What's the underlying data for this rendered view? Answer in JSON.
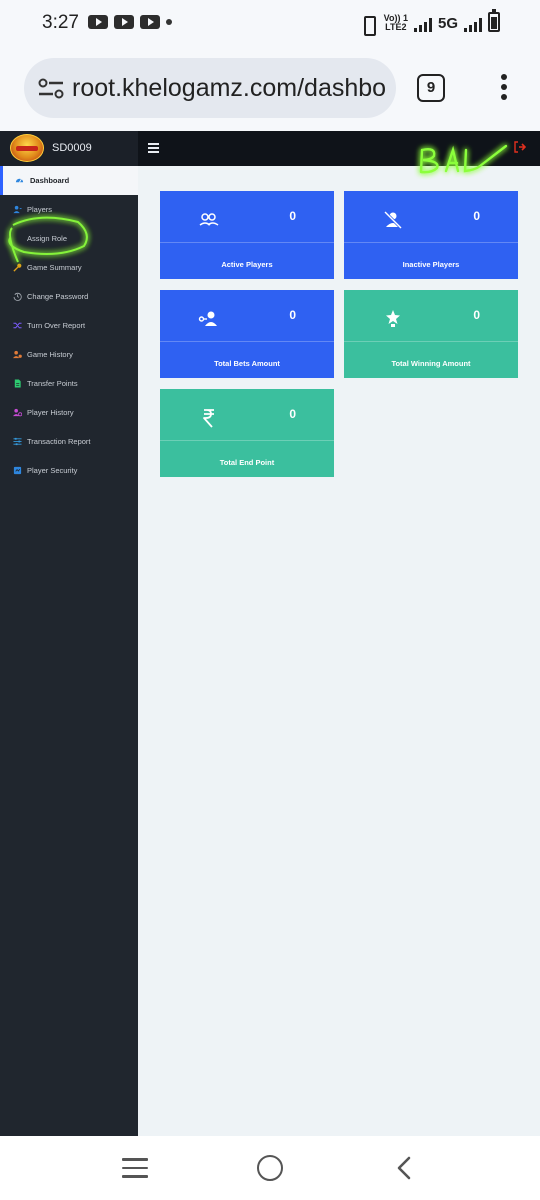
{
  "status_bar": {
    "time": "3:27",
    "volte_top": "Vo)) 1",
    "volte_bottom": "LTE2",
    "network": "5G"
  },
  "browser": {
    "url": "root.khelogamz.com/dashbo",
    "tab_count": "9"
  },
  "app": {
    "user_id": "SD0009"
  },
  "sidebar": {
    "items": [
      {
        "label": "Dashboard",
        "icon": "dashboard-gauge-icon",
        "color": "#2e86de"
      },
      {
        "label": "Players",
        "icon": "user-icon",
        "color": "#2e86de"
      },
      {
        "label": "Assign Role",
        "icon": "none",
        "color": "#c8cdd4"
      },
      {
        "label": "Game Summary",
        "icon": "key-icon",
        "color": "#e0a21b"
      },
      {
        "label": "Change Password",
        "icon": "history-icon",
        "color": "#9aa0a8"
      },
      {
        "label": "Turn Over Report",
        "icon": "shuffle-icon",
        "color": "#7c5cff"
      },
      {
        "label": "Game History",
        "icon": "users-clock-icon",
        "color": "#e07b39"
      },
      {
        "label": "Transfer Points",
        "icon": "file-icon",
        "color": "#2ecc71"
      },
      {
        "label": "Player History",
        "icon": "user-history-icon",
        "color": "#c64bd4"
      },
      {
        "label": "Transaction Report",
        "icon": "sliders-icon",
        "color": "#3498db"
      },
      {
        "label": "Player Security",
        "icon": "shield-doc-icon",
        "color": "#2e86de"
      }
    ]
  },
  "cards": [
    {
      "label": "Active Players",
      "count": "0",
      "icon": "users-outline-icon",
      "color": "#2f61f2"
    },
    {
      "label": "Inactive Players",
      "count": "0",
      "icon": "user-slash-icon",
      "color": "#2f61f2"
    },
    {
      "label": "Total Bets Amount",
      "count": "0",
      "icon": "user-key-icon",
      "color": "#2f61f2"
    },
    {
      "label": "Total Winning Amount",
      "count": "0",
      "icon": "star-trophy-icon",
      "color": "#3bbf9e"
    },
    {
      "label": "Total End Point",
      "count": "0",
      "icon": "rupee-icon",
      "color": "#3bbf9e"
    }
  ],
  "annotations": {
    "handwritten_text": "BAL",
    "highlight_color": "#8bff3a"
  }
}
